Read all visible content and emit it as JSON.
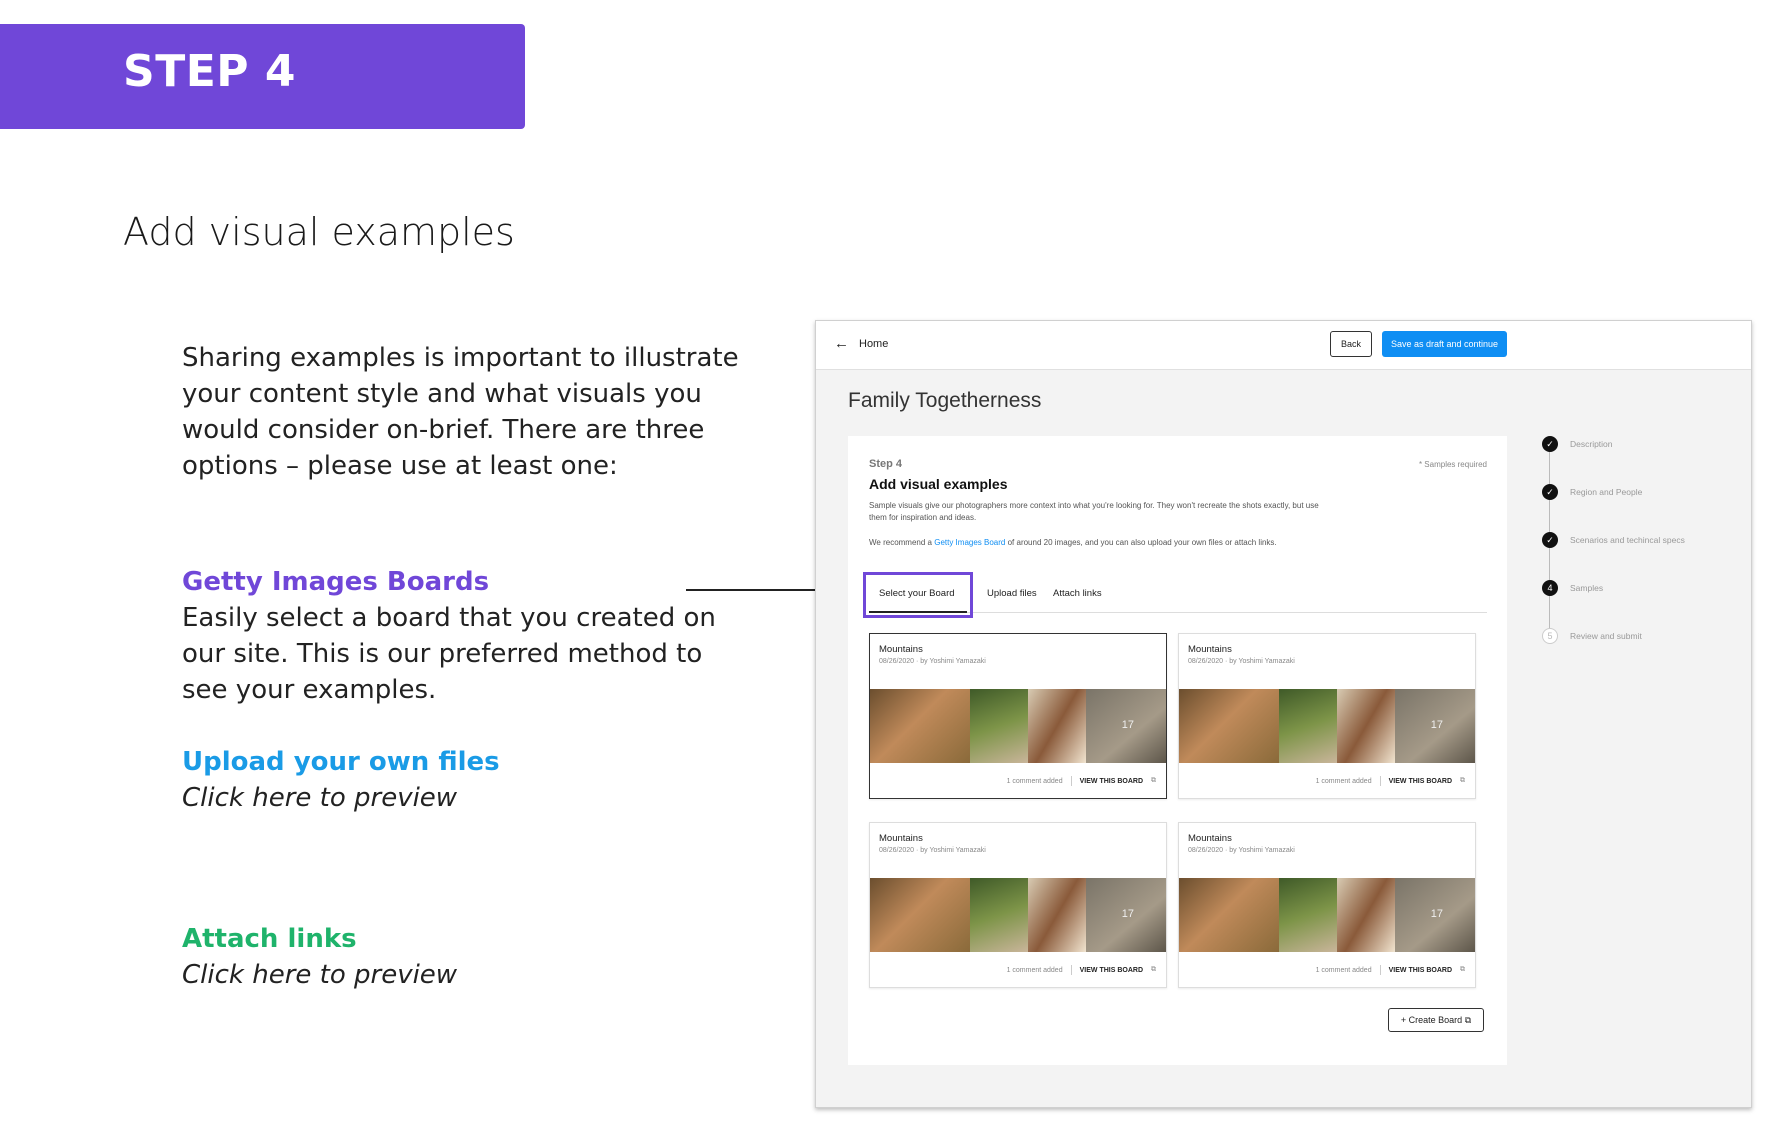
{
  "banner": {
    "label": "STEP 4"
  },
  "heading": "Add visual examples",
  "intro": "Sharing examples is important to illustrate your content style and what visuals you would consider on-brief. There are three options – please use at least one:",
  "options": {
    "getty": {
      "title": "Getty Images Boards",
      "desc": "Easily select a board that you created on our site. This is our preferred method to see your examples."
    },
    "upload": {
      "title": "Upload your own files",
      "preview": "Click here to preview"
    },
    "links": {
      "title": "Attach links",
      "preview": "Click here to preview"
    }
  },
  "colors": {
    "banner": "#7047d8",
    "getty": "#7047d8",
    "upload": "#1a9be6",
    "links": "#1fb36b",
    "primary_button": "#0f8ef3"
  },
  "screenshot": {
    "nav": {
      "back_icon": "arrow-left-icon",
      "back_arrow": "←",
      "home": "Home",
      "back_button": "Back",
      "save_button": "Save as draft and continue"
    },
    "project_title": "Family Togetherness",
    "card": {
      "step": "Step 4",
      "required": "* Samples required",
      "title": "Add visual examples",
      "desc": "Sample visuals give our photographers more context into what you're looking for. They won't recreate the shots exactly, but use them for inspiration and ideas.",
      "rec_pre": "We recommend a ",
      "rec_link": "Getty Images Board",
      "rec_post": " of around 20 images, and you can also upload your own files or attach links.",
      "tabs": [
        "Select your Board",
        "Upload files",
        "Attach links"
      ],
      "boards": [
        {
          "name": "Mountains",
          "date": "08/26/2020",
          "author": "by Yoshimi Yamazaki",
          "count": "17",
          "comments": "1 comment added",
          "view": "VIEW THIS BOARD"
        },
        {
          "name": "Mountains",
          "date": "08/26/2020",
          "author": "by Yoshimi Yamazaki",
          "count": "17",
          "comments": "1 comment added",
          "view": "VIEW THIS BOARD"
        },
        {
          "name": "Mountains",
          "date": "08/26/2020",
          "author": "by Yoshimi Yamazaki",
          "count": "17",
          "comments": "1 comment added",
          "view": "VIEW THIS BOARD"
        },
        {
          "name": "Mountains",
          "date": "08/26/2020",
          "author": "by Yoshimi Yamazaki",
          "count": "17",
          "comments": "1 comment added",
          "view": "VIEW THIS BOARD"
        }
      ],
      "external_icon": "⧉",
      "create_board": "+ Create Board"
    },
    "steps": [
      {
        "label": "Description",
        "status": "done",
        "mark": "✓"
      },
      {
        "label": "Region and People",
        "status": "done",
        "mark": "✓"
      },
      {
        "label": "Scenarios and techincal specs",
        "status": "done",
        "mark": "✓"
      },
      {
        "label": "Samples",
        "status": "current",
        "mark": "4"
      },
      {
        "label": "Review and submit",
        "status": "future",
        "mark": "5"
      }
    ]
  }
}
